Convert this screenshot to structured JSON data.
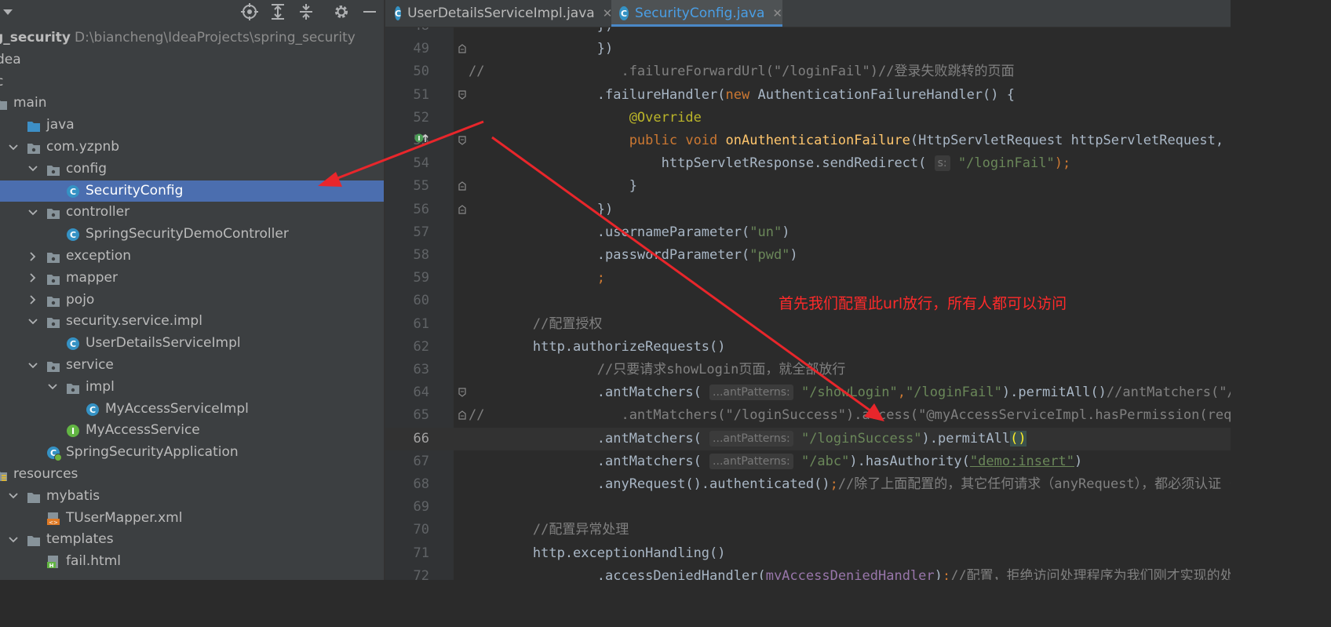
{
  "project_panel": {
    "tree": [
      {
        "label": "ng_security",
        "path": "D:\\biancheng\\IdeaProjects\\spring_security",
        "depth": -1,
        "icon": "module-icon",
        "arrow": "none",
        "bold": true
      },
      {
        "label": "dea",
        "depth": -1,
        "icon": "none",
        "arrow": "none"
      },
      {
        "label": "c",
        "depth": -1,
        "icon": "none",
        "arrow": "none"
      },
      {
        "label": "main",
        "depth": -1,
        "icon": "folder-icon",
        "arrow": "none"
      },
      {
        "label": "java",
        "depth": 0,
        "icon": "source-folder-icon",
        "arrow": "none"
      },
      {
        "label": "com.yzpnb",
        "depth": 0,
        "icon": "package-icon",
        "arrow": "down"
      },
      {
        "label": "config",
        "depth": 1,
        "icon": "package-icon",
        "arrow": "down"
      },
      {
        "label": "SecurityConfig",
        "depth": 2,
        "icon": "class-icon",
        "arrow": "none",
        "selected": true
      },
      {
        "label": "controller",
        "depth": 1,
        "icon": "package-icon",
        "arrow": "down"
      },
      {
        "label": "SpringSecurityDemoController",
        "depth": 2,
        "icon": "class-icon",
        "arrow": "none"
      },
      {
        "label": "exception",
        "depth": 1,
        "icon": "package-icon",
        "arrow": "right"
      },
      {
        "label": "mapper",
        "depth": 1,
        "icon": "package-icon",
        "arrow": "right"
      },
      {
        "label": "pojo",
        "depth": 1,
        "icon": "package-icon",
        "arrow": "right"
      },
      {
        "label": "security.service.impl",
        "depth": 1,
        "icon": "package-icon",
        "arrow": "down"
      },
      {
        "label": "UserDetailsServiceImpl",
        "depth": 2,
        "icon": "class-icon",
        "arrow": "none"
      },
      {
        "label": "service",
        "depth": 1,
        "icon": "package-icon",
        "arrow": "down"
      },
      {
        "label": "impl",
        "depth": 2,
        "icon": "package-icon",
        "arrow": "down"
      },
      {
        "label": "MyAccessServiceImpl",
        "depth": 3,
        "icon": "class-icon",
        "arrow": "none"
      },
      {
        "label": "MyAccessService",
        "depth": 2,
        "icon": "interface-icon",
        "arrow": "none"
      },
      {
        "label": "SpringSecurityApplication",
        "depth": 1,
        "icon": "spring-boot-class-icon",
        "arrow": "none"
      },
      {
        "label": "resources",
        "depth": -1,
        "icon": "resources-folder-icon",
        "arrow": "none"
      },
      {
        "label": "mybatis",
        "depth": 0,
        "icon": "folder-icon",
        "arrow": "down"
      },
      {
        "label": "TUserMapper.xml",
        "depth": 1,
        "icon": "xml-file-icon",
        "arrow": "none"
      },
      {
        "label": "templates",
        "depth": 0,
        "icon": "folder-icon",
        "arrow": "down"
      },
      {
        "label": "fail.html",
        "depth": 1,
        "icon": "html-file-icon",
        "arrow": "none"
      }
    ]
  },
  "tabs": [
    {
      "label": "UserDetailsServiceImpl.java",
      "active": false
    },
    {
      "label": "SecurityConfig.java",
      "active": true
    }
  ],
  "editor": {
    "lines": [
      {
        "n": "48",
        "segs": [
          [
            "plain",
            "                })"
          ]
        ]
      },
      {
        "n": "49",
        "segs": [
          [
            "plain",
            "                })"
          ]
        ]
      },
      {
        "n": "50",
        "segs": [
          [
            "cmt",
            "//                 .failureForwardUrl(\"/loginFail\")//登录失败跳转的页面"
          ]
        ]
      },
      {
        "n": "51",
        "segs": [
          [
            "plain",
            "                .failureHandler("
          ],
          [
            "kw",
            "new "
          ],
          [
            "plain",
            "AuthenticationFailureHandler() {"
          ]
        ]
      },
      {
        "n": "52",
        "segs": [
          [
            "ann",
            "                    @Override"
          ]
        ]
      },
      {
        "n": "53",
        "segs": [
          [
            "kw",
            "                    public void "
          ],
          [
            "fn",
            "onAuthenticationFailure"
          ],
          [
            "plain",
            "(HttpServletRequest httpServletRequest, HttpServletResponse"
          ]
        ]
      },
      {
        "n": "54",
        "segs": [
          [
            "plain",
            "                        httpServletResponse.sendRedirect( "
          ],
          [
            "hint",
            "s:"
          ],
          [
            "str",
            " \"/loginFail\""
          ],
          [
            "kw",
            ");"
          ]
        ]
      },
      {
        "n": "55",
        "segs": [
          [
            "plain",
            "                    }"
          ]
        ]
      },
      {
        "n": "56",
        "segs": [
          [
            "plain",
            "                })"
          ]
        ]
      },
      {
        "n": "57",
        "segs": [
          [
            "plain",
            "                .usernameParameter("
          ],
          [
            "str",
            "\"un\""
          ],
          [
            "plain",
            ")"
          ]
        ]
      },
      {
        "n": "58",
        "segs": [
          [
            "plain",
            "                .passwordParameter("
          ],
          [
            "str",
            "\"pwd\""
          ],
          [
            "plain",
            ")"
          ]
        ]
      },
      {
        "n": "59",
        "segs": [
          [
            "kw",
            "                ;"
          ]
        ]
      },
      {
        "n": "60",
        "segs": [
          [
            "plain",
            ""
          ]
        ]
      },
      {
        "n": "61",
        "segs": [
          [
            "cmt",
            "        //配置授权"
          ]
        ]
      },
      {
        "n": "62",
        "segs": [
          [
            "plain",
            "        http.authorizeRequests()"
          ]
        ]
      },
      {
        "n": "63",
        "segs": [
          [
            "cmt",
            "                //只要请求showLogin页面，就全部放行"
          ]
        ]
      },
      {
        "n": "64",
        "segs": [
          [
            "plain",
            "                .antMatchers( "
          ],
          [
            "hint",
            "...antPatterns:"
          ],
          [
            "str",
            " \"/showLogin\""
          ],
          [
            "kw",
            ","
          ],
          [
            "str",
            "\"/loginFail\""
          ],
          [
            "plain",
            ").permitAll()"
          ],
          [
            "cmt",
            "//antMatchers(\"/showLogin\").permitAll()"
          ]
        ]
      },
      {
        "n": "65",
        "segs": [
          [
            "cmt",
            "//                 .antMatchers(\"/loginSuccess\").access(\"@myAccessServiceImpl.hasPermission(request,authen"
          ]
        ]
      },
      {
        "n": "66",
        "segs": [
          [
            "plain",
            "                .antMatchers( "
          ],
          [
            "hint",
            "...antPatterns:"
          ],
          [
            "str",
            " \"/loginSuccess\""
          ],
          [
            "plain",
            ").permitAll"
          ],
          [
            "bh",
            "()"
          ]
        ],
        "current": true
      },
      {
        "n": "67",
        "segs": [
          [
            "plain",
            "                .antMatchers( "
          ],
          [
            "hint",
            "...antPatterns:"
          ],
          [
            "str",
            " \"/abc\""
          ],
          [
            "plain",
            ").hasAuthority("
          ],
          [
            "strul",
            "\"demo:insert\""
          ],
          [
            "plain",
            ")"
          ]
        ]
      },
      {
        "n": "68",
        "segs": [
          [
            "plain",
            "                .anyRequest().authenticated()"
          ],
          [
            "kw",
            ";"
          ],
          [
            "cmt",
            "//除了上面配置的，其它任何请求（anyRequest），都必须认证（authenticated）"
          ]
        ]
      },
      {
        "n": "69",
        "segs": [
          [
            "plain",
            ""
          ]
        ]
      },
      {
        "n": "70",
        "segs": [
          [
            "cmt",
            "        //配置异常处理"
          ]
        ]
      },
      {
        "n": "71",
        "segs": [
          [
            "plain",
            "        http.exceptionHandling()"
          ]
        ]
      },
      {
        "n": "72",
        "segs": [
          [
            "plain",
            "                .accessDeniedHandler("
          ],
          [
            "fld",
            "myAccessDeniedHandler"
          ],
          [
            "plain",
            ")"
          ],
          [
            "kw",
            ";"
          ],
          [
            "cmt",
            "//配置，拒绝访问处理程序为我们刚才实现的处理程序"
          ]
        ]
      }
    ]
  },
  "annotation": {
    "text": "首先我们配置此url放行，所有人都可以访问",
    "color": "#ff2a2a"
  },
  "colors": {
    "keyword": "#cc7832",
    "string": "#6a8759",
    "comment": "#808080",
    "method": "#ffc66d",
    "annotation": "#bbb529",
    "field": "#9876aa",
    "selection": "#4b6eaf",
    "class_icon": "#3592c4"
  }
}
